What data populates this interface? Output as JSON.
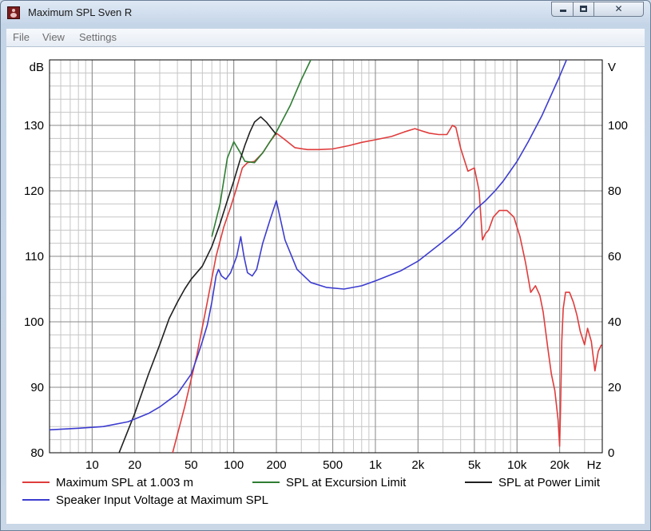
{
  "window": {
    "title": "Maximum SPL Sven R"
  },
  "menu": {
    "items": [
      "File",
      "View",
      "Settings"
    ]
  },
  "colors": {
    "red": "#e03c3c",
    "green": "#2e7d32",
    "black": "#202020",
    "blue": "#3c3cd0",
    "grid_major": "#8a8a8a",
    "grid_minor": "#c6c6c6"
  },
  "icons": {
    "app": "speaker-icon",
    "minimize": "minimize-icon",
    "maximize": "maximize-icon",
    "close": "close-icon"
  },
  "chart_data": {
    "type": "line",
    "xscale": "log",
    "xlim": [
      5,
      40000
    ],
    "ylim": [
      80,
      140
    ],
    "y2lim": [
      0,
      120
    ],
    "ylabel": "dB",
    "y2label": "V",
    "xunit": "Hz",
    "x_ticks": [
      {
        "v": 10,
        "label": "10"
      },
      {
        "v": 20,
        "label": "20"
      },
      {
        "v": 50,
        "label": "50"
      },
      {
        "v": 100,
        "label": "100"
      },
      {
        "v": 200,
        "label": "200"
      },
      {
        "v": 500,
        "label": "500"
      },
      {
        "v": 1000,
        "label": "1k"
      },
      {
        "v": 2000,
        "label": "2k"
      },
      {
        "v": 5000,
        "label": "5k"
      },
      {
        "v": 10000,
        "label": "10k"
      },
      {
        "v": 20000,
        "label": "20k"
      }
    ],
    "y_ticks": [
      80,
      90,
      100,
      110,
      120,
      130
    ],
    "y2_ticks": [
      0,
      20,
      40,
      60,
      80,
      100
    ],
    "grid": true,
    "legend_position": "bottom",
    "series": [
      {
        "name": "Maximum SPL at 1.003 m",
        "axis": "left",
        "color": "#e03c3c",
        "x": [
          37,
          45,
          55,
          65,
          75,
          85,
          95,
          105,
          115,
          125,
          140,
          160,
          180,
          200,
          230,
          270,
          330,
          400,
          500,
          650,
          800,
          1000,
          1300,
          1600,
          1900,
          2100,
          2400,
          2800,
          3200,
          3500,
          3700,
          4000,
          4500,
          5000,
          5400,
          5700,
          6000,
          6300,
          6800,
          7500,
          8500,
          9500,
          10500,
          11500,
          12500,
          13500,
          14500,
          15300,
          16500,
          17500,
          18500,
          19500,
          20000,
          20300,
          20700,
          21200,
          22000,
          23500,
          25000,
          26500,
          28000,
          30000,
          31500,
          33500,
          35500,
          37500,
          39500
        ],
        "y": [
          80,
          87,
          95,
          103,
          110,
          114.5,
          117.5,
          120.5,
          123.5,
          124.3,
          124.5,
          125.8,
          127.5,
          128.8,
          127.8,
          126.6,
          126.3,
          126.3,
          126.4,
          126.9,
          127.4,
          127.8,
          128.3,
          129,
          129.5,
          129.2,
          128.8,
          128.6,
          128.6,
          130,
          129.7,
          126.5,
          123,
          123.5,
          120,
          112.5,
          113.5,
          114,
          116,
          117,
          117,
          116,
          113,
          109,
          104.5,
          105.5,
          104,
          101.5,
          96,
          92,
          89.5,
          85,
          81,
          87,
          97,
          102,
          104.5,
          104.5,
          103,
          101,
          98.5,
          96.5,
          99,
          97,
          92.5,
          95.5,
          96.5
        ]
      },
      {
        "name": "SPL at Excursion Limit",
        "axis": "left",
        "color": "#2e7d32",
        "x": [
          70,
          80,
          90,
          100,
          110,
          120,
          140,
          160,
          180,
          200,
          250,
          300,
          350,
          400
        ],
        "y": [
          113,
          118,
          125,
          127.5,
          126,
          124.5,
          124.3,
          125.8,
          127.5,
          129,
          133,
          137,
          140,
          142
        ]
      },
      {
        "name": "SPL at Power Limit",
        "axis": "left",
        "color": "#202020",
        "x": [
          15.5,
          20,
          25,
          30,
          35,
          40,
          45,
          50,
          60,
          70,
          80,
          90,
          100,
          110,
          120,
          130,
          140,
          155,
          170,
          185,
          200
        ],
        "y": [
          80,
          86,
          92,
          96.5,
          100.5,
          103,
          105,
          106.5,
          108.5,
          111.5,
          115,
          118.5,
          121.5,
          124.5,
          127,
          129,
          130.5,
          131.3,
          130.5,
          129.5,
          128.6
        ]
      },
      {
        "name": "Speaker Input Voltage at Maximum SPL",
        "axis": "right",
        "color": "#3c3cd0",
        "x": [
          5,
          8,
          12,
          18,
          25,
          30,
          40,
          50,
          55,
          60,
          65,
          70,
          75,
          78,
          82,
          88,
          95,
          105,
          112,
          118,
          125,
          135,
          145,
          160,
          180,
          200,
          230,
          280,
          350,
          450,
          600,
          800,
          1000,
          1500,
          2000,
          3000,
          4000,
          5000,
          6000,
          7000,
          8000,
          10000,
          12000,
          15000,
          20000,
          25000
        ],
        "y": [
          7,
          7.5,
          8,
          9.5,
          12,
          14,
          18,
          24,
          29,
          34,
          39,
          46,
          54,
          56,
          54,
          53,
          55,
          60,
          66,
          60,
          55,
          54,
          56,
          64,
          71,
          77,
          65,
          56,
          52,
          50.5,
          50,
          51,
          52.5,
          55.5,
          58.5,
          64.5,
          69,
          74,
          77,
          80,
          83,
          89,
          95,
          103,
          115,
          125
        ]
      }
    ]
  }
}
